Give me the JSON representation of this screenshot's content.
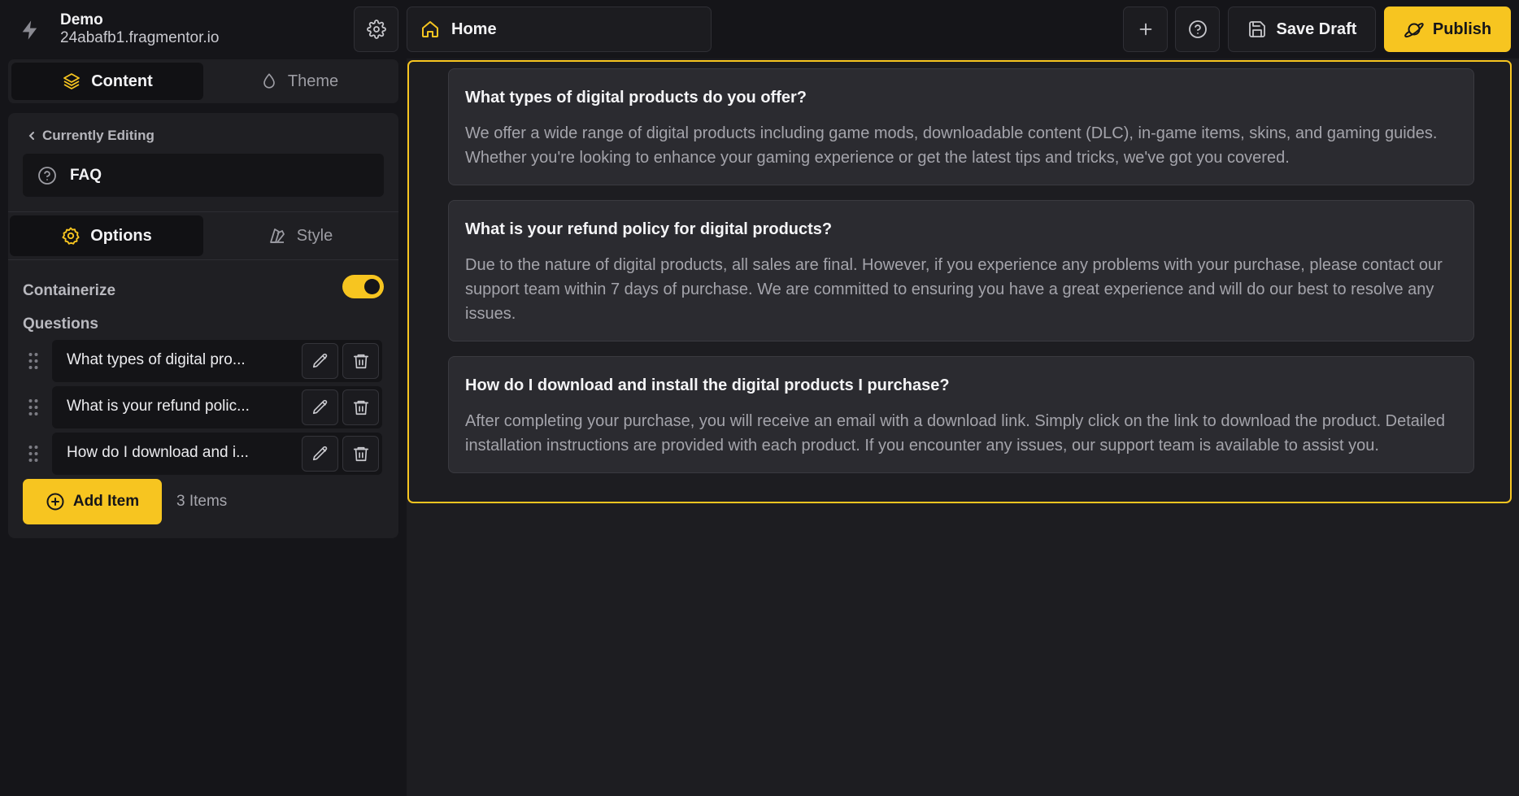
{
  "brand": {
    "name": "Demo",
    "domain": "24abafb1.fragmentor.io"
  },
  "header": {
    "page_label": "Home",
    "save_label": "Save Draft",
    "publish_label": "Publish"
  },
  "sidebar": {
    "tabs": [
      {
        "label": "Content",
        "active": true
      },
      {
        "label": "Theme",
        "active": false
      }
    ],
    "crumb_label": "Currently Editing",
    "editing_label": "FAQ",
    "subtabs": [
      {
        "label": "Options",
        "active": true
      },
      {
        "label": "Style",
        "active": false
      }
    ],
    "containerize_label": "Containerize",
    "containerize_on": true,
    "questions_label": "Questions",
    "questions": [
      "What types of digital pro...",
      "What is your refund polic...",
      "How do I download and i..."
    ],
    "add_label": "Add Item",
    "items_count": "3 Items"
  },
  "faq": [
    {
      "q": "What types of digital products do you offer?",
      "a": "We offer a wide range of digital products including game mods, downloadable content (DLC), in-game items, skins, and gaming guides. Whether you're looking to enhance your gaming experience or get the latest tips and tricks, we've got you covered."
    },
    {
      "q": "What is your refund policy for digital products?",
      "a": "Due to the nature of digital products, all sales are final. However, if you experience any problems with your purchase, please contact our support team within 7 days of purchase. We are committed to ensuring you have a great experience and will do our best to resolve any issues."
    },
    {
      "q": "How do I download and install the digital products I purchase?",
      "a": "After completing your purchase, you will receive an email with a download link. Simply click on the link to download the product. Detailed installation instructions are provided with each product. If you encounter any issues, our support team is available to assist you."
    }
  ],
  "colors": {
    "accent": "#f7c520",
    "background": "#151519",
    "canvas": "#1d1d21",
    "card": "#2b2b30"
  },
  "icons": [
    "bolt-icon",
    "gear-icon",
    "home-icon",
    "plus-icon",
    "help-circle-icon",
    "floppy-icon",
    "planet-icon",
    "layers-icon",
    "droplet-icon",
    "chevron-left-icon",
    "help-circle-icon",
    "settings-icon",
    "brush-icon",
    "drag-handle-icon",
    "pencil-icon",
    "trash-icon",
    "plus-circle-icon"
  ]
}
